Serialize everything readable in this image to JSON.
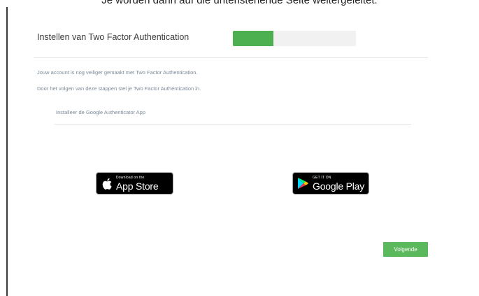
{
  "header_cut_text": "Je worden dann auf die untenstehende Seite weitergeleitet.",
  "title": "Instellen van Two Factor Authentication",
  "progress": {
    "fraction": 0.33,
    "fill_color": "#4caf50",
    "track_color": "#f1f1f1"
  },
  "description_lines": [
    "Jouw account is nog veiliger gemaakt met Two Factor Authentication.",
    "Door het volgen van deze stappen stel je Two Factor Authentication in."
  ],
  "step": {
    "label": "Installeer de Google Authenticator App"
  },
  "badges": {
    "app_store": {
      "small_text": "Download on the",
      "large_text": "App Store",
      "icon": "apple-icon"
    },
    "google_play": {
      "small_text": "GET IT ON",
      "large_text": "Google Play",
      "icon": "google-play-icon"
    }
  },
  "next_button": {
    "label": "Volgende",
    "color": "#5cb85c"
  }
}
